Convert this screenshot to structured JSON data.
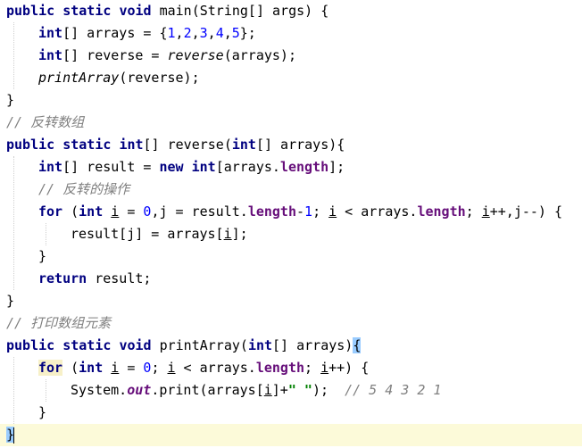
{
  "editor": {
    "lines": [
      {
        "tokens": [
          {
            "t": "public",
            "c": "kw"
          },
          {
            "t": " ",
            "c": ""
          },
          {
            "t": "static",
            "c": "kw"
          },
          {
            "t": " ",
            "c": ""
          },
          {
            "t": "void",
            "c": "kw"
          },
          {
            "t": " main(String[] args) {",
            "c": ""
          }
        ]
      },
      {
        "indent": 1,
        "tokens": [
          {
            "t": "int",
            "c": "kw"
          },
          {
            "t": "[] arrays = {",
            "c": ""
          },
          {
            "t": "1",
            "c": "num"
          },
          {
            "t": ",",
            "c": ""
          },
          {
            "t": "2",
            "c": "num"
          },
          {
            "t": ",",
            "c": ""
          },
          {
            "t": "3",
            "c": "num"
          },
          {
            "t": ",",
            "c": ""
          },
          {
            "t": "4",
            "c": "num"
          },
          {
            "t": ",",
            "c": ""
          },
          {
            "t": "5",
            "c": "num"
          },
          {
            "t": "};",
            "c": ""
          }
        ]
      },
      {
        "indent": 1,
        "tokens": [
          {
            "t": "int",
            "c": "kw"
          },
          {
            "t": "[] reverse = ",
            "c": ""
          },
          {
            "t": "reverse",
            "c": "static-call"
          },
          {
            "t": "(arrays);",
            "c": ""
          }
        ]
      },
      {
        "indent": 1,
        "tokens": [
          {
            "t": "printArray",
            "c": "static-call"
          },
          {
            "t": "(reverse);",
            "c": ""
          }
        ]
      },
      {
        "tokens": [
          {
            "t": "}",
            "c": ""
          }
        ]
      },
      {
        "tokens": [
          {
            "t": "// 反转数组",
            "c": "comment"
          }
        ]
      },
      {
        "tokens": [
          {
            "t": "public",
            "c": "kw"
          },
          {
            "t": " ",
            "c": ""
          },
          {
            "t": "static",
            "c": "kw"
          },
          {
            "t": " ",
            "c": ""
          },
          {
            "t": "int",
            "c": "kw"
          },
          {
            "t": "[] reverse(",
            "c": ""
          },
          {
            "t": "int",
            "c": "kw"
          },
          {
            "t": "[] arrays){",
            "c": ""
          }
        ]
      },
      {
        "indent": 1,
        "tokens": [
          {
            "t": "int",
            "c": "kw"
          },
          {
            "t": "[] result = ",
            "c": ""
          },
          {
            "t": "new",
            "c": "kw"
          },
          {
            "t": " ",
            "c": ""
          },
          {
            "t": "int",
            "c": "kw"
          },
          {
            "t": "[arrays.",
            "c": ""
          },
          {
            "t": "length",
            "c": "field"
          },
          {
            "t": "];",
            "c": ""
          }
        ]
      },
      {
        "indent": 1,
        "tokens": [
          {
            "t": "// 反转的操作",
            "c": "comment"
          }
        ]
      },
      {
        "indent": 1,
        "tokens": [
          {
            "t": "for",
            "c": "kw"
          },
          {
            "t": " (",
            "c": ""
          },
          {
            "t": "int",
            "c": "kw"
          },
          {
            "t": " ",
            "c": ""
          },
          {
            "t": "i",
            "c": "ul"
          },
          {
            "t": " = ",
            "c": ""
          },
          {
            "t": "0",
            "c": "num"
          },
          {
            "t": ",j = result.",
            "c": ""
          },
          {
            "t": "length",
            "c": "field"
          },
          {
            "t": "-",
            "c": ""
          },
          {
            "t": "1",
            "c": "num"
          },
          {
            "t": "; ",
            "c": ""
          },
          {
            "t": "i",
            "c": "ul"
          },
          {
            "t": " < arrays.",
            "c": ""
          },
          {
            "t": "length",
            "c": "field"
          },
          {
            "t": "; ",
            "c": ""
          },
          {
            "t": "i",
            "c": "ul"
          },
          {
            "t": "++,j--) {",
            "c": ""
          }
        ]
      },
      {
        "indent": 2,
        "tokens": [
          {
            "t": "result[j] = arrays[",
            "c": ""
          },
          {
            "t": "i",
            "c": "ul"
          },
          {
            "t": "];",
            "c": ""
          }
        ]
      },
      {
        "indent": 1,
        "tokens": [
          {
            "t": "}",
            "c": ""
          }
        ]
      },
      {
        "indent": 1,
        "tokens": [
          {
            "t": "return",
            "c": "kw"
          },
          {
            "t": " result;",
            "c": ""
          }
        ]
      },
      {
        "tokens": [
          {
            "t": "}",
            "c": ""
          }
        ]
      },
      {
        "tokens": [
          {
            "t": "// 打印数组元素",
            "c": "comment"
          }
        ]
      },
      {
        "tokens": [
          {
            "t": "public",
            "c": "kw"
          },
          {
            "t": " ",
            "c": ""
          },
          {
            "t": "static",
            "c": "kw"
          },
          {
            "t": " ",
            "c": ""
          },
          {
            "t": "void",
            "c": "kw"
          },
          {
            "t": " printArray(",
            "c": ""
          },
          {
            "t": "int",
            "c": "kw"
          },
          {
            "t": "[] arrays)",
            "c": ""
          },
          {
            "t": "{",
            "c": "brace-hl"
          }
        ]
      },
      {
        "indent": 1,
        "tokens": [
          {
            "t": "for",
            "c": "kw for-hl"
          },
          {
            "t": " (",
            "c": ""
          },
          {
            "t": "int",
            "c": "kw"
          },
          {
            "t": " ",
            "c": ""
          },
          {
            "t": "i",
            "c": "ul"
          },
          {
            "t": " = ",
            "c": ""
          },
          {
            "t": "0",
            "c": "num"
          },
          {
            "t": "; ",
            "c": ""
          },
          {
            "t": "i",
            "c": "ul"
          },
          {
            "t": " < arrays.",
            "c": ""
          },
          {
            "t": "length",
            "c": "field"
          },
          {
            "t": "; ",
            "c": ""
          },
          {
            "t": "i",
            "c": "ul"
          },
          {
            "t": "++) {",
            "c": ""
          }
        ]
      },
      {
        "indent": 2,
        "tokens": [
          {
            "t": "System.",
            "c": ""
          },
          {
            "t": "out",
            "c": "static-field"
          },
          {
            "t": ".print(arrays[",
            "c": ""
          },
          {
            "t": "i",
            "c": "ul"
          },
          {
            "t": "]+",
            "c": ""
          },
          {
            "t": "\" \"",
            "c": "str"
          },
          {
            "t": ");  ",
            "c": ""
          },
          {
            "t": "// 5 4 3 2 1",
            "c": "comment"
          }
        ]
      },
      {
        "indent": 1,
        "tokens": [
          {
            "t": "}",
            "c": ""
          }
        ]
      },
      {
        "current": true,
        "tokens": [
          {
            "t": "}",
            "c": "brace-hl"
          },
          {
            "t": "",
            "c": "caret"
          }
        ]
      }
    ]
  }
}
